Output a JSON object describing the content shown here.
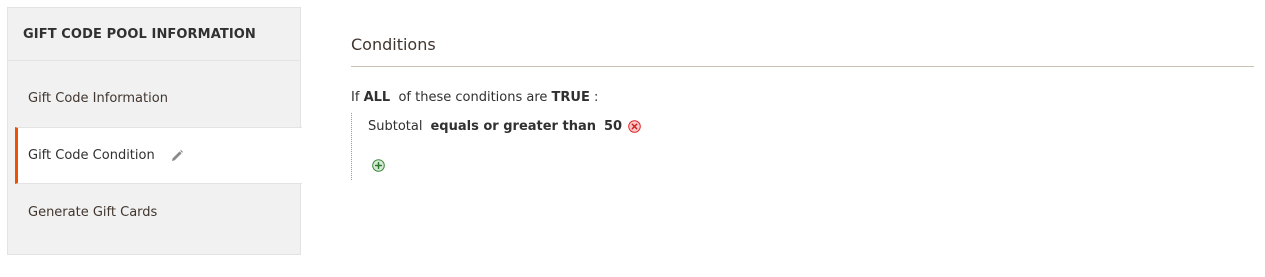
{
  "sidebar": {
    "title": "GIFT CODE POOL INFORMATION",
    "items": [
      {
        "label": "Gift Code Information",
        "active": false
      },
      {
        "label": "Gift Code Condition",
        "active": true
      },
      {
        "label": "Generate Gift Cards",
        "active": false
      }
    ]
  },
  "main": {
    "section_title": "Conditions",
    "condition_header": {
      "prefix": "If",
      "aggregator": "ALL",
      "middle": "of these conditions are",
      "value": "TRUE",
      "suffix": ":"
    },
    "conditions": [
      {
        "attribute": "Subtotal",
        "operator": "equals or greater than",
        "value": "50"
      }
    ]
  },
  "colors": {
    "accent": "#eb5202",
    "remove": "#e22626",
    "add": "#3b8a3b"
  }
}
